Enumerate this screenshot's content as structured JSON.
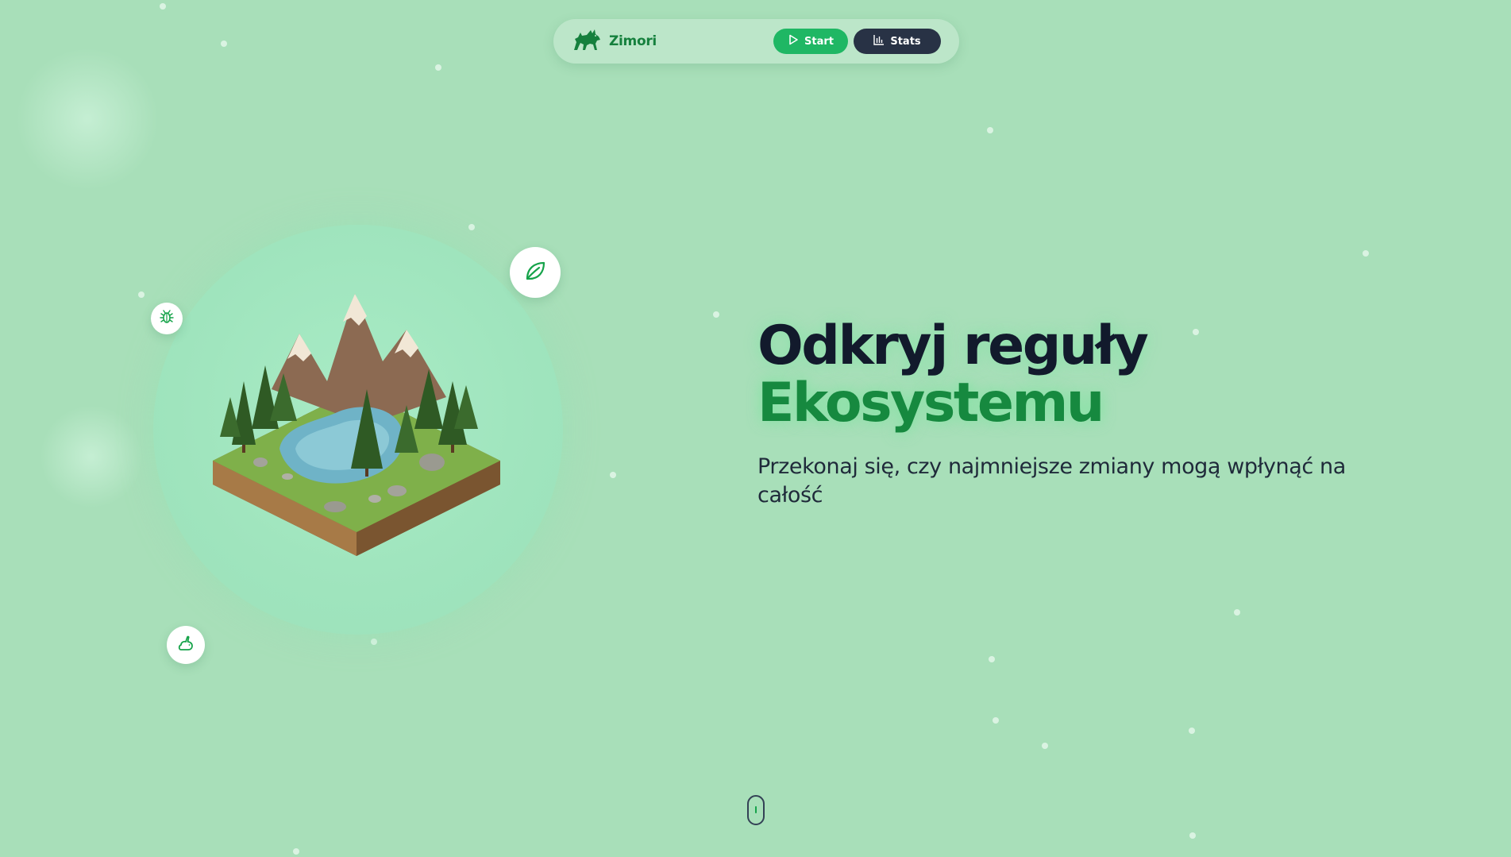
{
  "nav": {
    "brand_name": "Zimori",
    "brand_icon": "wolf-logo-icon",
    "start_label": "Start",
    "start_icon": "play-icon",
    "stats_label": "Stats",
    "stats_icon": "bar-chart-icon"
  },
  "hero": {
    "title_line1": "Odkryj reguły",
    "title_line2": "Ekosystemu",
    "subtitle": "Przekonaj się, czy najmniejsze zmiany mogą wpłynąć na całość",
    "illustration": "forest-lake-island",
    "badges": [
      "leaf-icon",
      "bug-icon",
      "rabbit-icon"
    ]
  },
  "scroll_indicator": "mouse-scroll-icon",
  "colors": {
    "background": "#a8dfb9",
    "accent_green": "#1fb764",
    "dark_button": "#283245",
    "title_dark": "#121a2c",
    "title_green": "#16893f"
  }
}
